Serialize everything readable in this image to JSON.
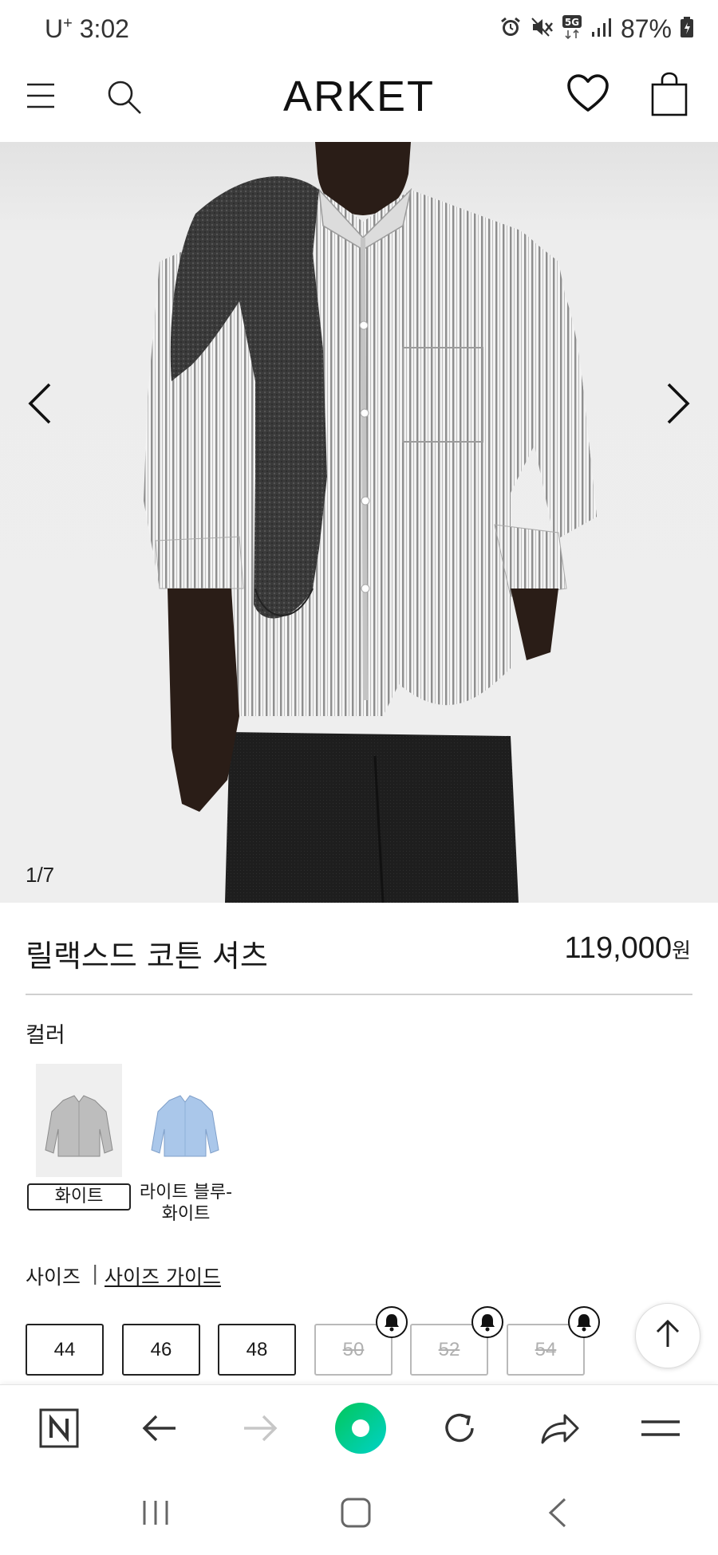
{
  "status_bar": {
    "carrier": "U",
    "carrier_sup": "+",
    "time": "3:02",
    "battery_percent": "87%",
    "icons": [
      "alarm-icon",
      "mute-icon",
      "5g-icon",
      "signal-icon",
      "battery-icon"
    ]
  },
  "header": {
    "brand": "ARKET",
    "icons": [
      "menu-icon",
      "search-icon",
      "heart-icon",
      "bag-icon"
    ]
  },
  "gallery": {
    "counter": "1/7",
    "current": 1,
    "total": 7,
    "icons": [
      "chevron-left-icon",
      "chevron-right-icon"
    ]
  },
  "product": {
    "title": "릴랙스드 코튼 셔츠",
    "price": "119,000",
    "price_unit": "원"
  },
  "color": {
    "label": "컬러",
    "options": [
      {
        "label": "화이트",
        "selected": true
      },
      {
        "label_line1": "라이트 블루-",
        "label_line2": "화이트",
        "selected": false
      }
    ]
  },
  "size": {
    "label": "사이즈",
    "separator": "|",
    "guide_link": "사이즈 가이드",
    "options": [
      {
        "label": "44",
        "available": true
      },
      {
        "label": "46",
        "available": true
      },
      {
        "label": "48",
        "available": true
      },
      {
        "label": "50",
        "available": false
      },
      {
        "label": "52",
        "available": false
      },
      {
        "label": "54",
        "available": false
      }
    ]
  },
  "browser_bar": {
    "icons": [
      "naver-icon",
      "back-arrow-icon",
      "forward-arrow-icon",
      "green-dot-icon",
      "refresh-icon",
      "share-icon",
      "hamburger-icon"
    ]
  },
  "system_nav": {
    "icons": [
      "recents-icon",
      "home-icon",
      "back-icon"
    ]
  },
  "colors": {
    "accent_green": "#03c75a",
    "accent_cyan": "#00d2c8",
    "text_dark": "#1a1a1a",
    "disabled_gray": "#b0b0b0",
    "image_bg": "#ececec"
  }
}
